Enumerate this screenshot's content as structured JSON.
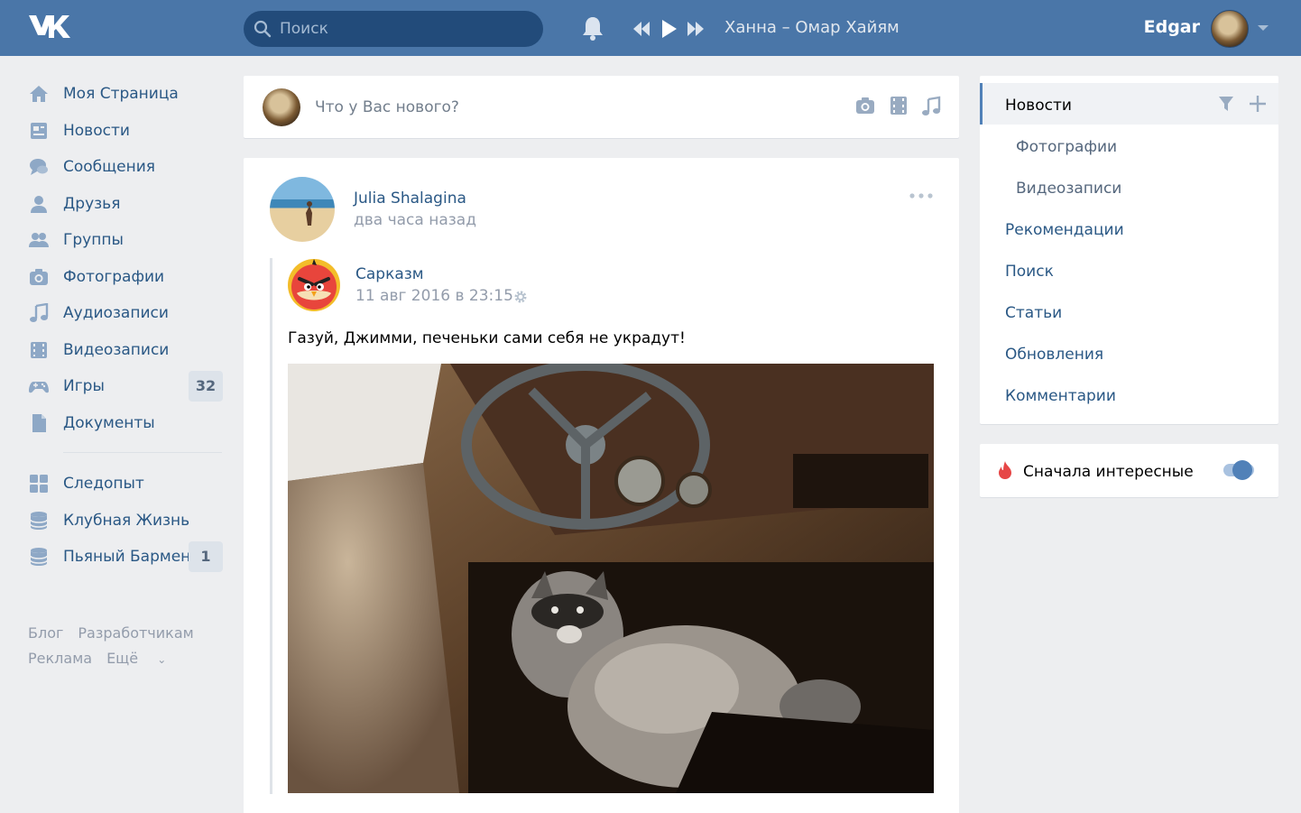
{
  "colors": {
    "header": "#4a76a8",
    "link": "#2a5885",
    "muted": "#939cab",
    "accent": "#5181b8",
    "background": "#edeef0"
  },
  "header": {
    "logo": "VK",
    "search_placeholder": "Поиск",
    "now_playing": "Ханна – Омар Хайям",
    "user_name": "Edgar",
    "icons": [
      "search-icon",
      "bell-icon",
      "prev-track-icon",
      "play-icon",
      "next-track-icon",
      "chevron-down-icon"
    ]
  },
  "sidebar": {
    "items": [
      {
        "label": "Моя Страница",
        "icon": "home-icon"
      },
      {
        "label": "Новости",
        "icon": "news-icon"
      },
      {
        "label": "Сообщения",
        "icon": "messages-icon"
      },
      {
        "label": "Друзья",
        "icon": "friend-icon"
      },
      {
        "label": "Группы",
        "icon": "groups-icon"
      },
      {
        "label": "Фотографии",
        "icon": "camera-icon"
      },
      {
        "label": "Аудиозаписи",
        "icon": "music-icon"
      },
      {
        "label": "Видеозаписи",
        "icon": "film-icon"
      },
      {
        "label": "Игры",
        "icon": "gamepad-icon",
        "badge": "32"
      },
      {
        "label": "Документы",
        "icon": "document-icon"
      }
    ],
    "apps": [
      {
        "label": "Следопыт",
        "icon": "apps-grid-icon"
      },
      {
        "label": "Клубная Жизнь",
        "icon": "app-stack-icon"
      },
      {
        "label": "Пьяный Бармен",
        "icon": "app-stack-icon",
        "badge": "1"
      }
    ],
    "footer": {
      "blog": "Блог",
      "developers": "Разработчикам",
      "ads": "Реклама",
      "more": "Ещё"
    }
  },
  "composer": {
    "placeholder": "Что у Вас нового?"
  },
  "post": {
    "author": "Julia Shalagina",
    "time": "два часа назад",
    "repost": {
      "source": "Сарказм",
      "date": "11 авг 2016 в 23:15",
      "text": "Газуй, Джимми, печеньки сами себя не украдут!"
    }
  },
  "news_menu": {
    "items": [
      "Новости",
      "Фотографии",
      "Видеозаписи",
      "Рекомендации",
      "Поиск",
      "Статьи",
      "Обновления",
      "Комментарии"
    ]
  },
  "interesting": {
    "label": "Сначала интересные",
    "enabled": true
  }
}
